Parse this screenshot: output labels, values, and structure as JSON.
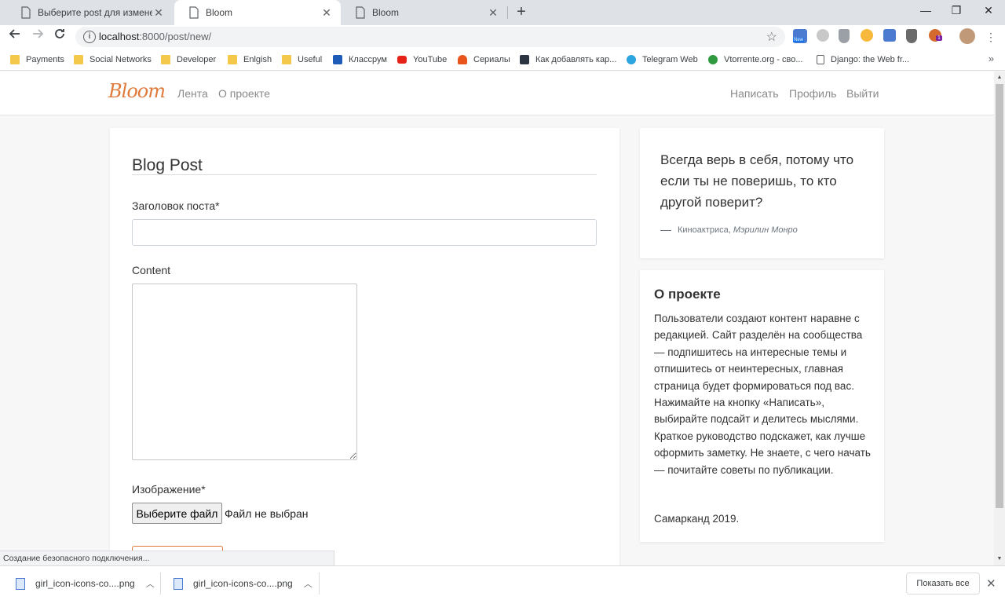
{
  "browser": {
    "tabs": [
      {
        "title": "Выберите post для изменения |",
        "active": false
      },
      {
        "title": "Bloom",
        "active": true
      },
      {
        "title": "Bloom",
        "active": false
      }
    ],
    "newtab_symbol": "+",
    "window_controls": {
      "minimize": "—",
      "restore": "❐",
      "close": "✕"
    },
    "url_host": "localhost",
    "url_path": ":8000/post/new/",
    "ext_badge_new": "New",
    "ext_badge_count": "1"
  },
  "bookmarks": [
    {
      "label": "Payments",
      "icon": "folder"
    },
    {
      "label": "Social Networks",
      "icon": "folder"
    },
    {
      "label": "Developer",
      "icon": "folder"
    },
    {
      "label": "Enlgish",
      "icon": "folder"
    },
    {
      "label": "Useful",
      "icon": "folder"
    },
    {
      "label": "Классрум",
      "icon": "classroom",
      "color": "#1e5bb8"
    },
    {
      "label": "YouTube",
      "icon": "youtube",
      "color": "#e62117"
    },
    {
      "label": "Сериалы",
      "icon": "flame",
      "color": "#e8541c"
    },
    {
      "label": "Как добавлять кар...",
      "icon": "bookmark-dark",
      "color": "#2b3440"
    },
    {
      "label": "Telegram Web",
      "icon": "telegram",
      "color": "#2ca5e0"
    },
    {
      "label": "Vtorrente.org - сво...",
      "icon": "vtorrente",
      "color": "#2f9a3f"
    },
    {
      "label": "Django: the Web fr...",
      "icon": "page"
    }
  ],
  "bookmarks_more": "»",
  "site": {
    "brand": "Bloom",
    "brand_color": "#e07a3c",
    "nav_left": [
      "Лента",
      "О проекте"
    ],
    "nav_right": [
      "Написать",
      "Профиль",
      "Выйти"
    ]
  },
  "form": {
    "title": "Blog Post",
    "title_label": "Заголовок поста*",
    "title_value": "",
    "content_label": "Content",
    "content_value": "",
    "image_label": "Изображение*",
    "file_button": "Выберите файл",
    "file_status": "Файл не выбран"
  },
  "quote": {
    "text": "Всегда верь в себя, потому что если ты не поверишь, то кто другой поверит?",
    "role": "Киноактриса, ",
    "author": "Мэрилин Монро"
  },
  "about": {
    "title": "О проекте",
    "text": "Пользователи создают контент наравне с редакцией. Сайт разделён на сообщества — подпишитесь на интересные темы и отпишитесь от неинтересных, главная страница будет формироваться под вас. Нажимайте на кнопку «Написать», выбирайте подсайт и делитесь мыслями. Краткое руководство подскажет, как лучше оформить заметку. Не знаете, с чего начать — почитайте советы по публикации.",
    "footer": "Самарканд 2019."
  },
  "status_bar": "Создание безопасного подключения...",
  "downloads": {
    "items": [
      {
        "name": "girl_icon-icons-co....png"
      },
      {
        "name": "girl_icon-icons-co....png"
      }
    ],
    "show_all": "Показать все"
  }
}
